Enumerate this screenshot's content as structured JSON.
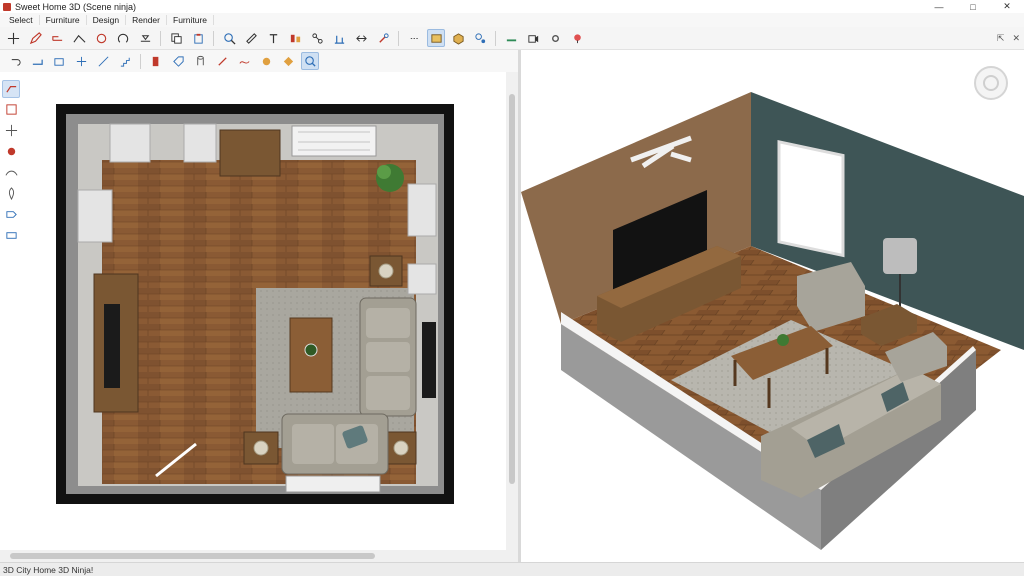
{
  "window": {
    "title": "Sweet Home 3D (Scene ninja)",
    "minimize": "—",
    "maximize": "□",
    "close": "✕"
  },
  "menu": {
    "items": [
      "Select",
      "Furniture",
      "Design",
      "Render",
      "Furniture"
    ]
  },
  "toolbar_right": {
    "arrow_label": "⇱",
    "close_label": "✕"
  },
  "status": {
    "text": "3D City Home 3D Ninja!"
  },
  "colors": {
    "accent": "#2f6fb7",
    "active_tool": "#cfe0f3",
    "floor_wood": "#8a5a34",
    "wall_brown": "#8c6a4b",
    "wall_teal": "#3e5556"
  }
}
